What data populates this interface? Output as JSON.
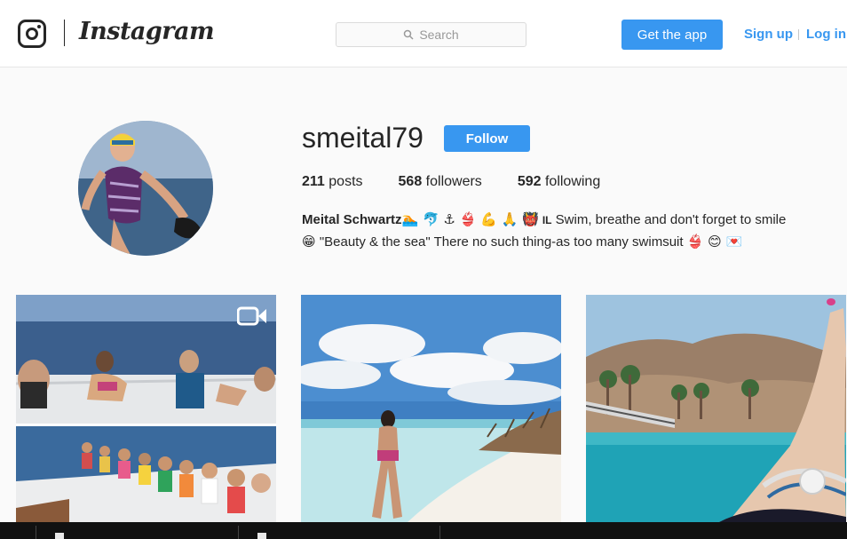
{
  "nav": {
    "wordmark": "Instagram",
    "search_placeholder": "Search",
    "get_app_label": "Get the app",
    "signup_label": "Sign up",
    "login_label": "Log in"
  },
  "profile": {
    "username": "smeital79",
    "follow_label": "Follow",
    "stats": {
      "posts_count": "211",
      "posts_label": "posts",
      "followers_count": "568",
      "followers_label": "followers",
      "following_count": "592",
      "following_label": "following"
    },
    "bio": {
      "full_name": "Meital Schwartz",
      "emojis_1": "🏊 🐬 ⚓ 👙 💪 🙏 👹",
      "flag": "IL",
      "text_1": "Swim, breathe and don't forget to smile",
      "emoji_2": "😁",
      "text_2": "\"Beauty & the sea\" There no such thing-as too many swimsuit",
      "emojis_3": "👙 😊 💌"
    }
  },
  "posts": [
    {
      "kind": "video",
      "icon": "video-camera-icon"
    },
    {
      "kind": "photo"
    },
    {
      "kind": "photo"
    }
  ],
  "colors": {
    "accent": "#3897f0",
    "text": "#262626",
    "background": "#fafafa"
  }
}
